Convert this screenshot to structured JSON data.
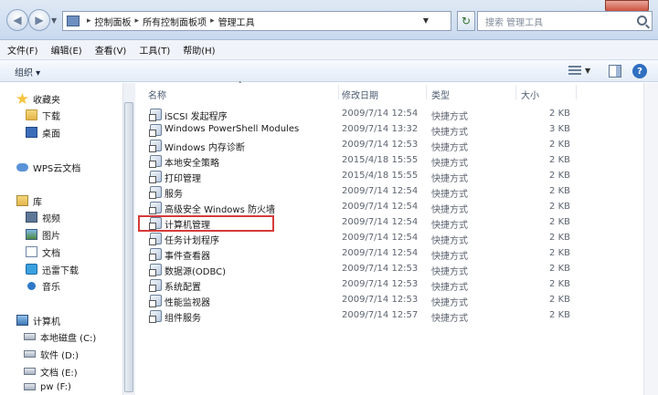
{
  "nav": {
    "breadcrumbs": [
      "控制面板",
      "所有控制面板项",
      "管理工具"
    ],
    "search_placeholder": "搜索 管理工具"
  },
  "menu": [
    "文件(F)",
    "编辑(E)",
    "查看(V)",
    "工具(T)",
    "帮助(H)"
  ],
  "command": {
    "organize": "组织 ▾"
  },
  "sidebar": {
    "items": [
      {
        "label": "收藏夹",
        "icon": "star-icon"
      },
      {
        "label": "下载",
        "icon": "folder-icon"
      },
      {
        "label": "桌面",
        "icon": "desktop-icon"
      },
      {
        "label": "WPS云文档",
        "icon": "cloud-icon"
      },
      {
        "label": "库",
        "icon": "library-icon"
      },
      {
        "label": "视频",
        "icon": "video-icon"
      },
      {
        "label": "图片",
        "icon": "picture-icon"
      },
      {
        "label": "文档",
        "icon": "document-icon"
      },
      {
        "label": "迅雷下载",
        "icon": "xunlei-icon"
      },
      {
        "label": "音乐",
        "icon": "music-icon"
      },
      {
        "label": "计算机",
        "icon": "computer-icon"
      },
      {
        "label": "本地磁盘 (C:)",
        "icon": "drive-icon"
      },
      {
        "label": "软件 (D:)",
        "icon": "drive-icon"
      },
      {
        "label": "文档 (E:)",
        "icon": "drive-icon"
      },
      {
        "label": "pw (F:)",
        "icon": "drive-icon"
      }
    ]
  },
  "columns": {
    "name": "名称",
    "date": "修改日期",
    "type": "类型",
    "size": "大小"
  },
  "files": [
    {
      "name": "iSCSI 发起程序",
      "date": "2009/7/14 12:54",
      "type": "快捷方式",
      "size": "2 KB"
    },
    {
      "name": "Windows PowerShell Modules",
      "date": "2009/7/14 13:32",
      "type": "快捷方式",
      "size": "3 KB"
    },
    {
      "name": "Windows 内存诊断",
      "date": "2009/7/14 12:53",
      "type": "快捷方式",
      "size": "2 KB"
    },
    {
      "name": "本地安全策略",
      "date": "2015/4/18 15:55",
      "type": "快捷方式",
      "size": "2 KB"
    },
    {
      "name": "打印管理",
      "date": "2015/4/18 15:55",
      "type": "快捷方式",
      "size": "2 KB"
    },
    {
      "name": "服务",
      "date": "2009/7/14 12:54",
      "type": "快捷方式",
      "size": "2 KB"
    },
    {
      "name": "高级安全 Windows 防火墙",
      "date": "2009/7/14 12:54",
      "type": "快捷方式",
      "size": "2 KB"
    },
    {
      "name": "计算机管理",
      "date": "2009/7/14 12:54",
      "type": "快捷方式",
      "size": "2 KB"
    },
    {
      "name": "任务计划程序",
      "date": "2009/7/14 12:54",
      "type": "快捷方式",
      "size": "2 KB"
    },
    {
      "name": "事件查看器",
      "date": "2009/7/14 12:54",
      "type": "快捷方式",
      "size": "2 KB"
    },
    {
      "name": "数据源(ODBC)",
      "date": "2009/7/14 12:53",
      "type": "快捷方式",
      "size": "2 KB"
    },
    {
      "name": "系统配置",
      "date": "2009/7/14 12:53",
      "type": "快捷方式",
      "size": "2 KB"
    },
    {
      "name": "性能监视器",
      "date": "2009/7/14 12:53",
      "type": "快捷方式",
      "size": "2 KB"
    },
    {
      "name": "组件服务",
      "date": "2009/7/14 12:57",
      "type": "快捷方式",
      "size": "2 KB"
    }
  ],
  "highlight_color": "#d63a3a"
}
